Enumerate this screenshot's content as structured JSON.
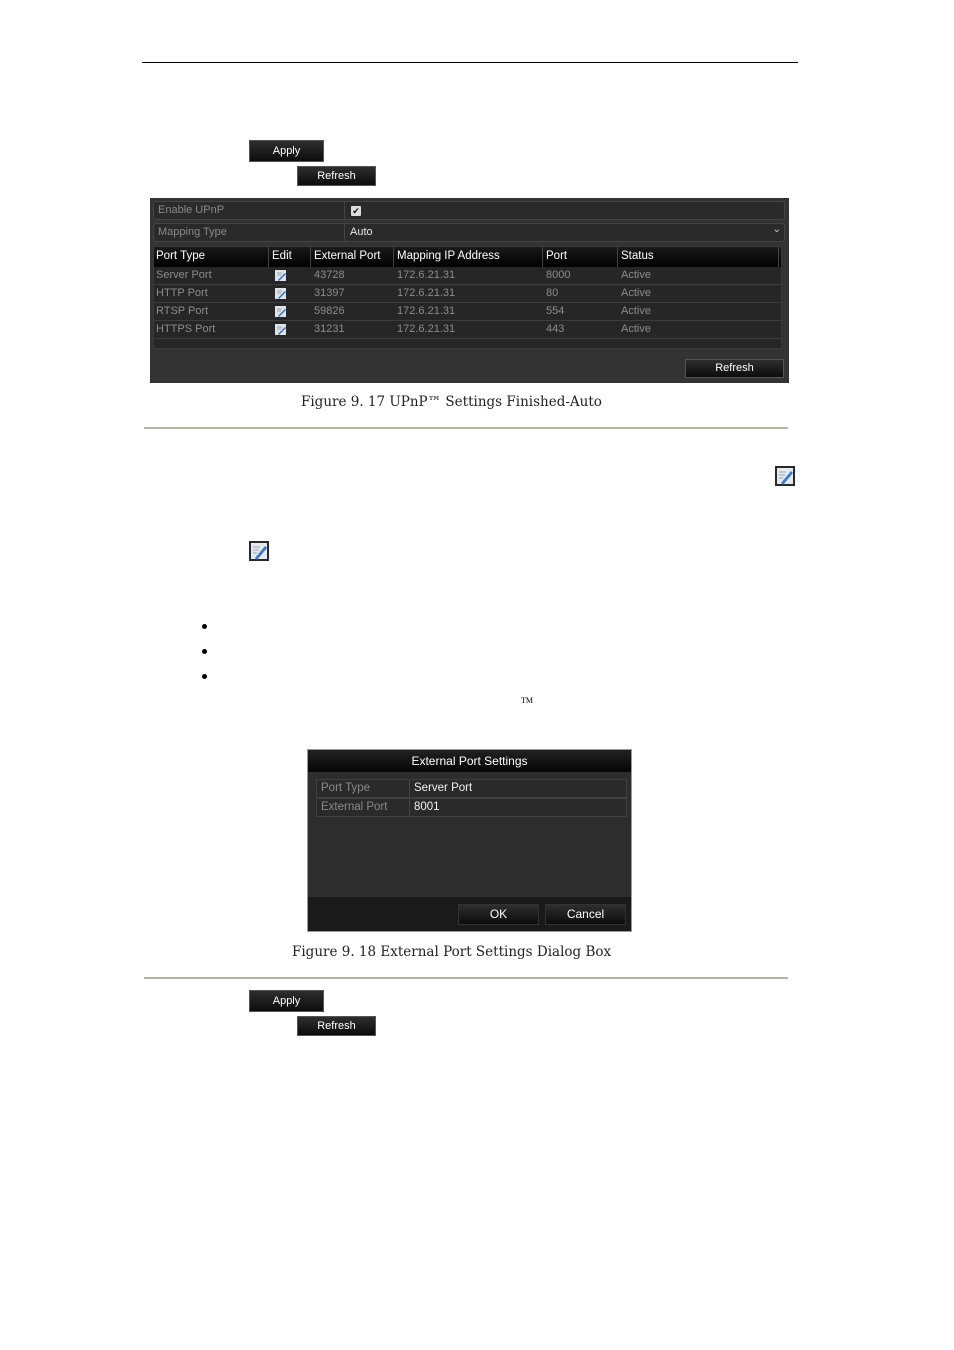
{
  "page": {
    "top_buttons": {
      "apply_label": "Apply",
      "refresh_label": "Refresh"
    },
    "bottom_buttons": {
      "apply_label": "Apply",
      "refresh_label": "Refresh"
    },
    "trademark": "TM"
  },
  "upnp_panel": {
    "enable_upnp": {
      "label": "Enable UPnP",
      "checked": true,
      "check_glyph": "✔"
    },
    "mapping_type": {
      "label": "Mapping Type",
      "value": "Auto",
      "arrow": "⌄"
    },
    "table": {
      "headers": [
        "Port Type",
        "Edit",
        "External Port",
        "Mapping IP Address",
        "Port",
        "Status"
      ],
      "rows": [
        {
          "port_type": "Server Port",
          "external_port": "43728",
          "mapping_ip": "172.6.21.31",
          "port": "8000",
          "status": "Active"
        },
        {
          "port_type": "HTTP Port",
          "external_port": "31397",
          "mapping_ip": "172.6.21.31",
          "port": "80",
          "status": "Active"
        },
        {
          "port_type": "RTSP Port",
          "external_port": "59826",
          "mapping_ip": "172.6.21.31",
          "port": "554",
          "status": "Active"
        },
        {
          "port_type": "HTTPS Port",
          "external_port": "31231",
          "mapping_ip": "172.6.21.31",
          "port": "443",
          "status": "Active"
        }
      ]
    },
    "refresh_label": "Refresh"
  },
  "figure_17_caption": "Figure 9. 17 UPnP™ Settings Finished-Auto",
  "dialog": {
    "title": "External Port Settings",
    "port_type": {
      "label": "Port Type",
      "value": "Server Port"
    },
    "external_port": {
      "label": "External Port",
      "value": "8001"
    },
    "ok_label": "OK",
    "cancel_label": "Cancel"
  },
  "figure_18_caption": "Figure 9. 18 External Port Settings Dialog Box"
}
